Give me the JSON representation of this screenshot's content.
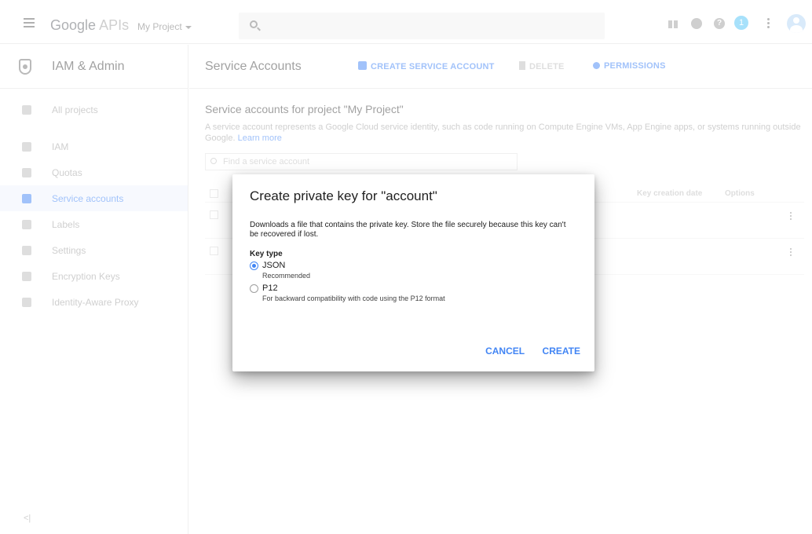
{
  "topbar": {
    "logo_google": "Google",
    "logo_apis": "APIs",
    "project": "My Project",
    "notification_count": "1"
  },
  "sidebar": {
    "title": "IAM & Admin",
    "items": [
      {
        "label": "All projects",
        "icon": "list-icon"
      },
      {
        "label": "IAM",
        "icon": "person-add-icon"
      },
      {
        "label": "Quotas",
        "icon": "quota-icon"
      },
      {
        "label": "Service accounts",
        "icon": "service-account-icon",
        "active": true
      },
      {
        "label": "Labels",
        "icon": "label-icon"
      },
      {
        "label": "Settings",
        "icon": "gear-icon"
      },
      {
        "label": "Encryption Keys",
        "icon": "key-icon"
      },
      {
        "label": "Identity-Aware Proxy",
        "icon": "proxy-icon"
      }
    ],
    "collapse": "<|"
  },
  "main": {
    "title": "Service Accounts",
    "create_label": "CREATE SERVICE ACCOUNT",
    "delete_label": "DELETE",
    "permissions_label": "PERMISSIONS",
    "section_title": "Service accounts for project \"My Project\"",
    "section_desc": "A service account represents a Google Cloud service identity, such as code running on Compute Engine VMs, App Engine apps, or systems running outside Google.",
    "learn_more": "Learn more",
    "filter_placeholder": "Find a service account",
    "col_key_date": "Key creation date",
    "col_options": "Options"
  },
  "dialog": {
    "title": "Create private key for \"account\"",
    "description": "Downloads a file that contains the private key. Store the file securely because this key can't be recovered if lost.",
    "key_type_label": "Key type",
    "options": [
      {
        "label": "JSON",
        "sub": "Recommended",
        "selected": true
      },
      {
        "label": "P12",
        "sub": "For backward compatibility with code using the P12 format",
        "selected": false
      }
    ],
    "cancel": "CANCEL",
    "create": "CREATE"
  },
  "colors": {
    "accent": "#4285f4",
    "sidebar_active_bg": "#eef3fd"
  }
}
